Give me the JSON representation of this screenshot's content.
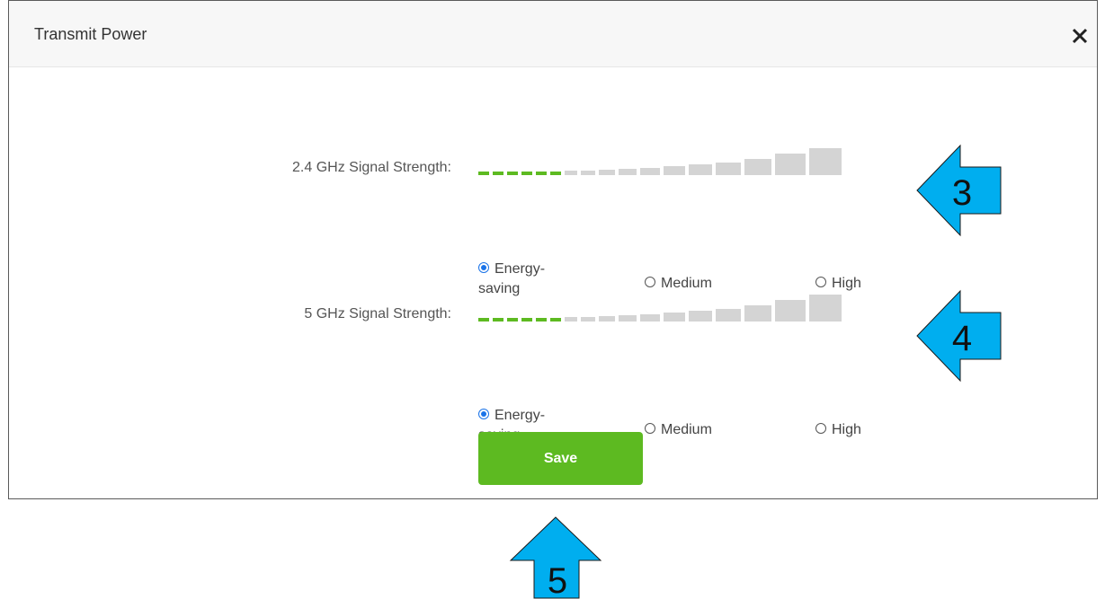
{
  "dialog": {
    "title": "Transmit Power",
    "close_icon": "close-icon"
  },
  "band_24": {
    "label": "2.4 GHz Signal Strength:",
    "level_fraction": 0.33,
    "options": [
      "Energy-saving",
      "Medium",
      "High"
    ],
    "selected": "Energy-saving",
    "option_labels": {
      "energy": "Energy-",
      "energy2": "saving",
      "medium": "Medium",
      "high": "High"
    }
  },
  "band_5": {
    "label": "5 GHz Signal Strength:",
    "level_fraction": 0.33,
    "options": [
      "Energy-saving",
      "Medium",
      "High"
    ],
    "selected": "Energy-saving",
    "option_labels": {
      "energy": "Energy-",
      "energy2": "saving",
      "medium": "Medium",
      "high": "High"
    }
  },
  "save_label": "Save",
  "callouts": [
    {
      "number": "3",
      "direction": "left",
      "color": "#00aeef"
    },
    {
      "number": "4",
      "direction": "left",
      "color": "#00aeef"
    },
    {
      "number": "5",
      "direction": "up",
      "color": "#00aeef"
    }
  ],
  "colors": {
    "active_bar": "#5dba21",
    "inactive_bar": "#d4d4d4",
    "save_button": "#5dba21",
    "radio_selected": "#1a73e8",
    "callout": "#00aeef"
  }
}
